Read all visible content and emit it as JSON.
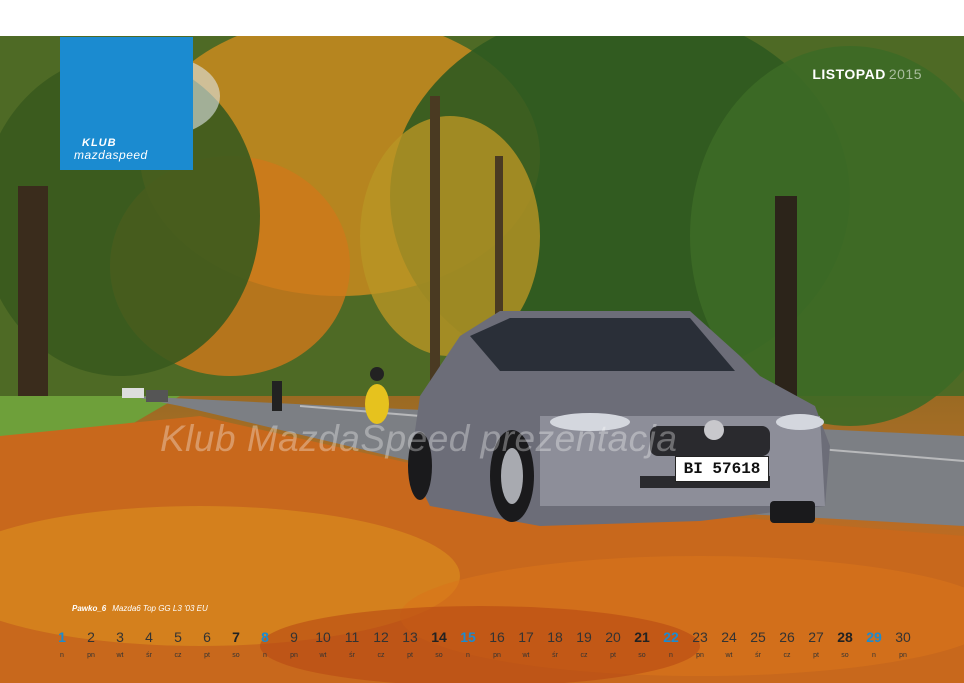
{
  "logo": {
    "line1": "KLUB",
    "line2": "mazdaspeed"
  },
  "month": {
    "name": "LISTOPAD",
    "year": "2015"
  },
  "watermark": "Klub MazdaSpeed prezentacja",
  "caption": {
    "author": "Pawko_6",
    "car": "Mazda6 Top GG L3 '03 EU"
  },
  "plate": "BI 57618",
  "calendar": {
    "days": [
      {
        "n": "1",
        "w": "n"
      },
      {
        "n": "2",
        "w": "pn"
      },
      {
        "n": "3",
        "w": "wt"
      },
      {
        "n": "4",
        "w": "śr"
      },
      {
        "n": "5",
        "w": "cz"
      },
      {
        "n": "6",
        "w": "pt"
      },
      {
        "n": "7",
        "w": "so"
      },
      {
        "n": "8",
        "w": "n"
      },
      {
        "n": "9",
        "w": "pn"
      },
      {
        "n": "10",
        "w": "wt"
      },
      {
        "n": "11",
        "w": "śr"
      },
      {
        "n": "12",
        "w": "cz"
      },
      {
        "n": "13",
        "w": "pt"
      },
      {
        "n": "14",
        "w": "so"
      },
      {
        "n": "15",
        "w": "n"
      },
      {
        "n": "16",
        "w": "pn"
      },
      {
        "n": "17",
        "w": "wt"
      },
      {
        "n": "18",
        "w": "śr"
      },
      {
        "n": "19",
        "w": "cz"
      },
      {
        "n": "20",
        "w": "pt"
      },
      {
        "n": "21",
        "w": "so"
      },
      {
        "n": "22",
        "w": "n"
      },
      {
        "n": "23",
        "w": "pn"
      },
      {
        "n": "24",
        "w": "wt"
      },
      {
        "n": "25",
        "w": "śr"
      },
      {
        "n": "26",
        "w": "cz"
      },
      {
        "n": "27",
        "w": "pt"
      },
      {
        "n": "28",
        "w": "so"
      },
      {
        "n": "29",
        "w": "n"
      },
      {
        "n": "30",
        "w": "pn"
      }
    ]
  },
  "colors": {
    "brand": "#1b8bd0",
    "sunday": "#1b8bd0"
  }
}
